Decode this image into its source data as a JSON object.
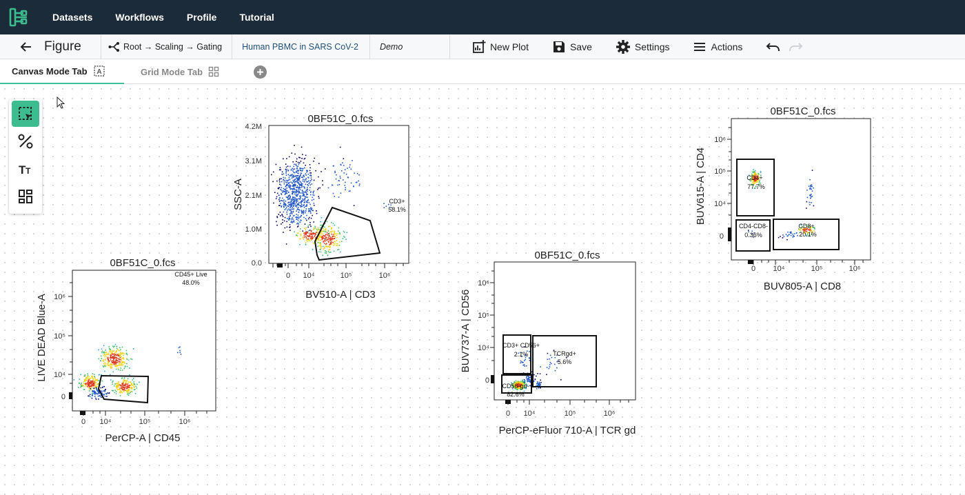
{
  "nav": {
    "items": [
      "Datasets",
      "Workflows",
      "Profile",
      "Tutorial"
    ],
    "logo_icon": "cytometry-logo-icon",
    "bg_color": "#1c2b3a"
  },
  "toolbar": {
    "title": "Figure",
    "breadcrumb": "Root → Scaling → Gating",
    "dataset": "Human PBMC in SARS CoV-2",
    "experiment": "Demo",
    "new_plot": "New Plot",
    "save": "Save",
    "settings": "Settings",
    "actions": "Actions"
  },
  "tabs": [
    {
      "label": "Canvas Mode Tab",
      "icon": "canvas-mode-icon",
      "active": true
    },
    {
      "label": "Grid Mode Tab",
      "icon": "grid-mode-icon",
      "active": false
    }
  ],
  "tools": [
    "select-region-icon",
    "gate-tool-icon",
    "text-tool-icon",
    "layout-tool-icon"
  ],
  "accent_color": "#3dbd8f",
  "plots": [
    {
      "title": "0BF51C_0.fcs",
      "x_axis": "BV510-A | CD3",
      "y_axis": "SSC-A",
      "x_ticks": [
        "0",
        "10⁴",
        "10⁵",
        "10⁶"
      ],
      "y_ticks": [
        "4.2M",
        "3.1M",
        "2.1M",
        "1.0M",
        "0.0"
      ],
      "gates": [
        {
          "name": "CD3+",
          "pct": "58.1%"
        }
      ]
    },
    {
      "title": "0BF51C_0.fcs",
      "x_axis": "PerCP-A | CD45",
      "y_axis": "LIVE DEAD Blue-A",
      "x_ticks": [
        "0",
        "10⁴",
        "10⁵",
        "10⁶"
      ],
      "y_ticks": [
        "10⁶",
        "10⁵",
        "10⁴",
        "0"
      ],
      "gates": [
        {
          "name": "CD45+ Live",
          "pct": "48.0%"
        }
      ]
    },
    {
      "title": "0BF51C_0.fcs",
      "x_axis": "PerCP-eFluor 710-A | TCR gd",
      "y_axis": "BUV737-A | CD56",
      "x_ticks": [
        "0",
        "10⁴",
        "10⁵",
        "10⁶"
      ],
      "y_ticks": [
        "10⁶",
        "10⁵",
        "10⁴",
        "0"
      ],
      "gates": [
        {
          "name": "CD3+ CD56+",
          "pct": "2.1%"
        },
        {
          "name": "TCRgd+",
          "pct": "5.6%"
        },
        {
          "name": "CD56-gd-",
          "pct": "82.6%"
        }
      ]
    },
    {
      "title": "0BF51C_0.fcs",
      "x_axis": "BUV805-A | CD8",
      "y_axis": "BUV615-A | CD4",
      "x_ticks": [
        "0",
        "10⁴",
        "10⁵",
        "10⁶"
      ],
      "y_ticks": [
        "10⁶",
        "10⁵",
        "10⁴",
        "0"
      ],
      "gates": [
        {
          "name": "CD4+",
          "pct": "77.7%"
        },
        {
          "name": "CD4-CD8-",
          "pct": "0.36%"
        },
        {
          "name": "CD8+",
          "pct": "20.1%"
        }
      ]
    }
  ]
}
